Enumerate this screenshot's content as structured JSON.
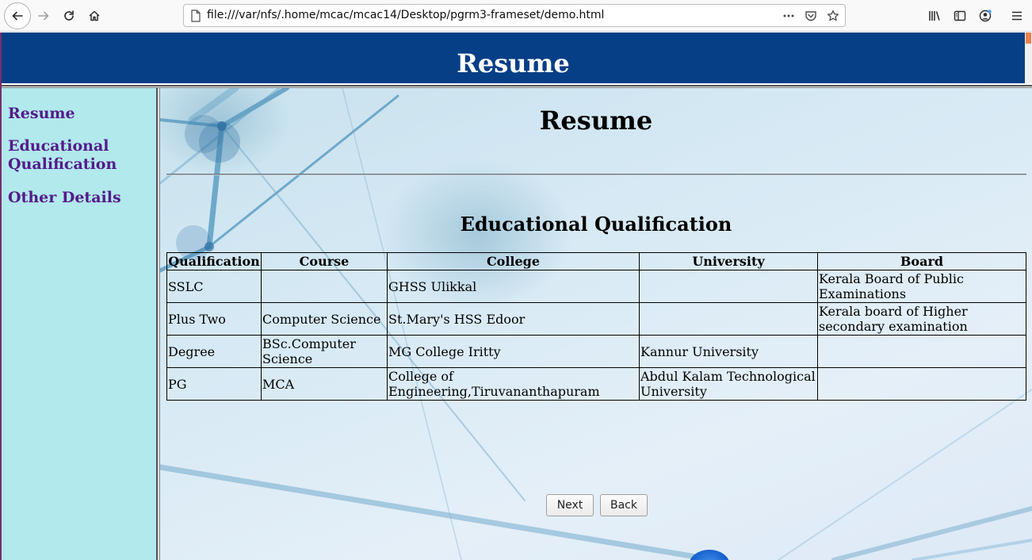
{
  "browser": {
    "url": "file:///var/nfs/.home/mcac/mcac14/Desktop/pgrm3-frameset/demo.html"
  },
  "header": {
    "title": "Resume"
  },
  "nav": {
    "links": [
      {
        "label": "Resume"
      },
      {
        "label_line1": "Educational",
        "label_line2": "Qualification"
      },
      {
        "label": "Other Details"
      }
    ]
  },
  "main": {
    "title": "Resume",
    "section_title": "Educational Qualification",
    "table": {
      "headers": [
        "Qualification",
        "Course",
        "College",
        "University",
        "Board"
      ],
      "rows": [
        [
          "SSLC",
          "",
          "GHSS Ulikkal",
          "",
          "Kerala Board of Public Examinations"
        ],
        [
          "Plus Two",
          "Computer Science",
          "St.Mary's HSS Edoor",
          "",
          "Kerala board of Higher secondary examination"
        ],
        [
          "Degree",
          "BSc.Computer Science",
          "MG College Iritty",
          "Kannur University",
          ""
        ],
        [
          "PG",
          "MCA",
          "College of Engineering,Tiruvananthapuram",
          "Abdul Kalam Technological University",
          ""
        ]
      ]
    },
    "buttons": {
      "next": "Next",
      "back": "Back"
    }
  },
  "colors": {
    "header_bg": "#063f86",
    "nav_bg": "#b1e9ec",
    "link": "#551a8b"
  },
  "icons": [
    "back-arrow-icon",
    "forward-arrow-icon",
    "reload-icon",
    "home-icon",
    "page-icon",
    "more-icon",
    "pocket-icon",
    "bookmark-star-icon",
    "library-icon",
    "sidebar-icon",
    "account-icon",
    "menu-icon"
  ]
}
